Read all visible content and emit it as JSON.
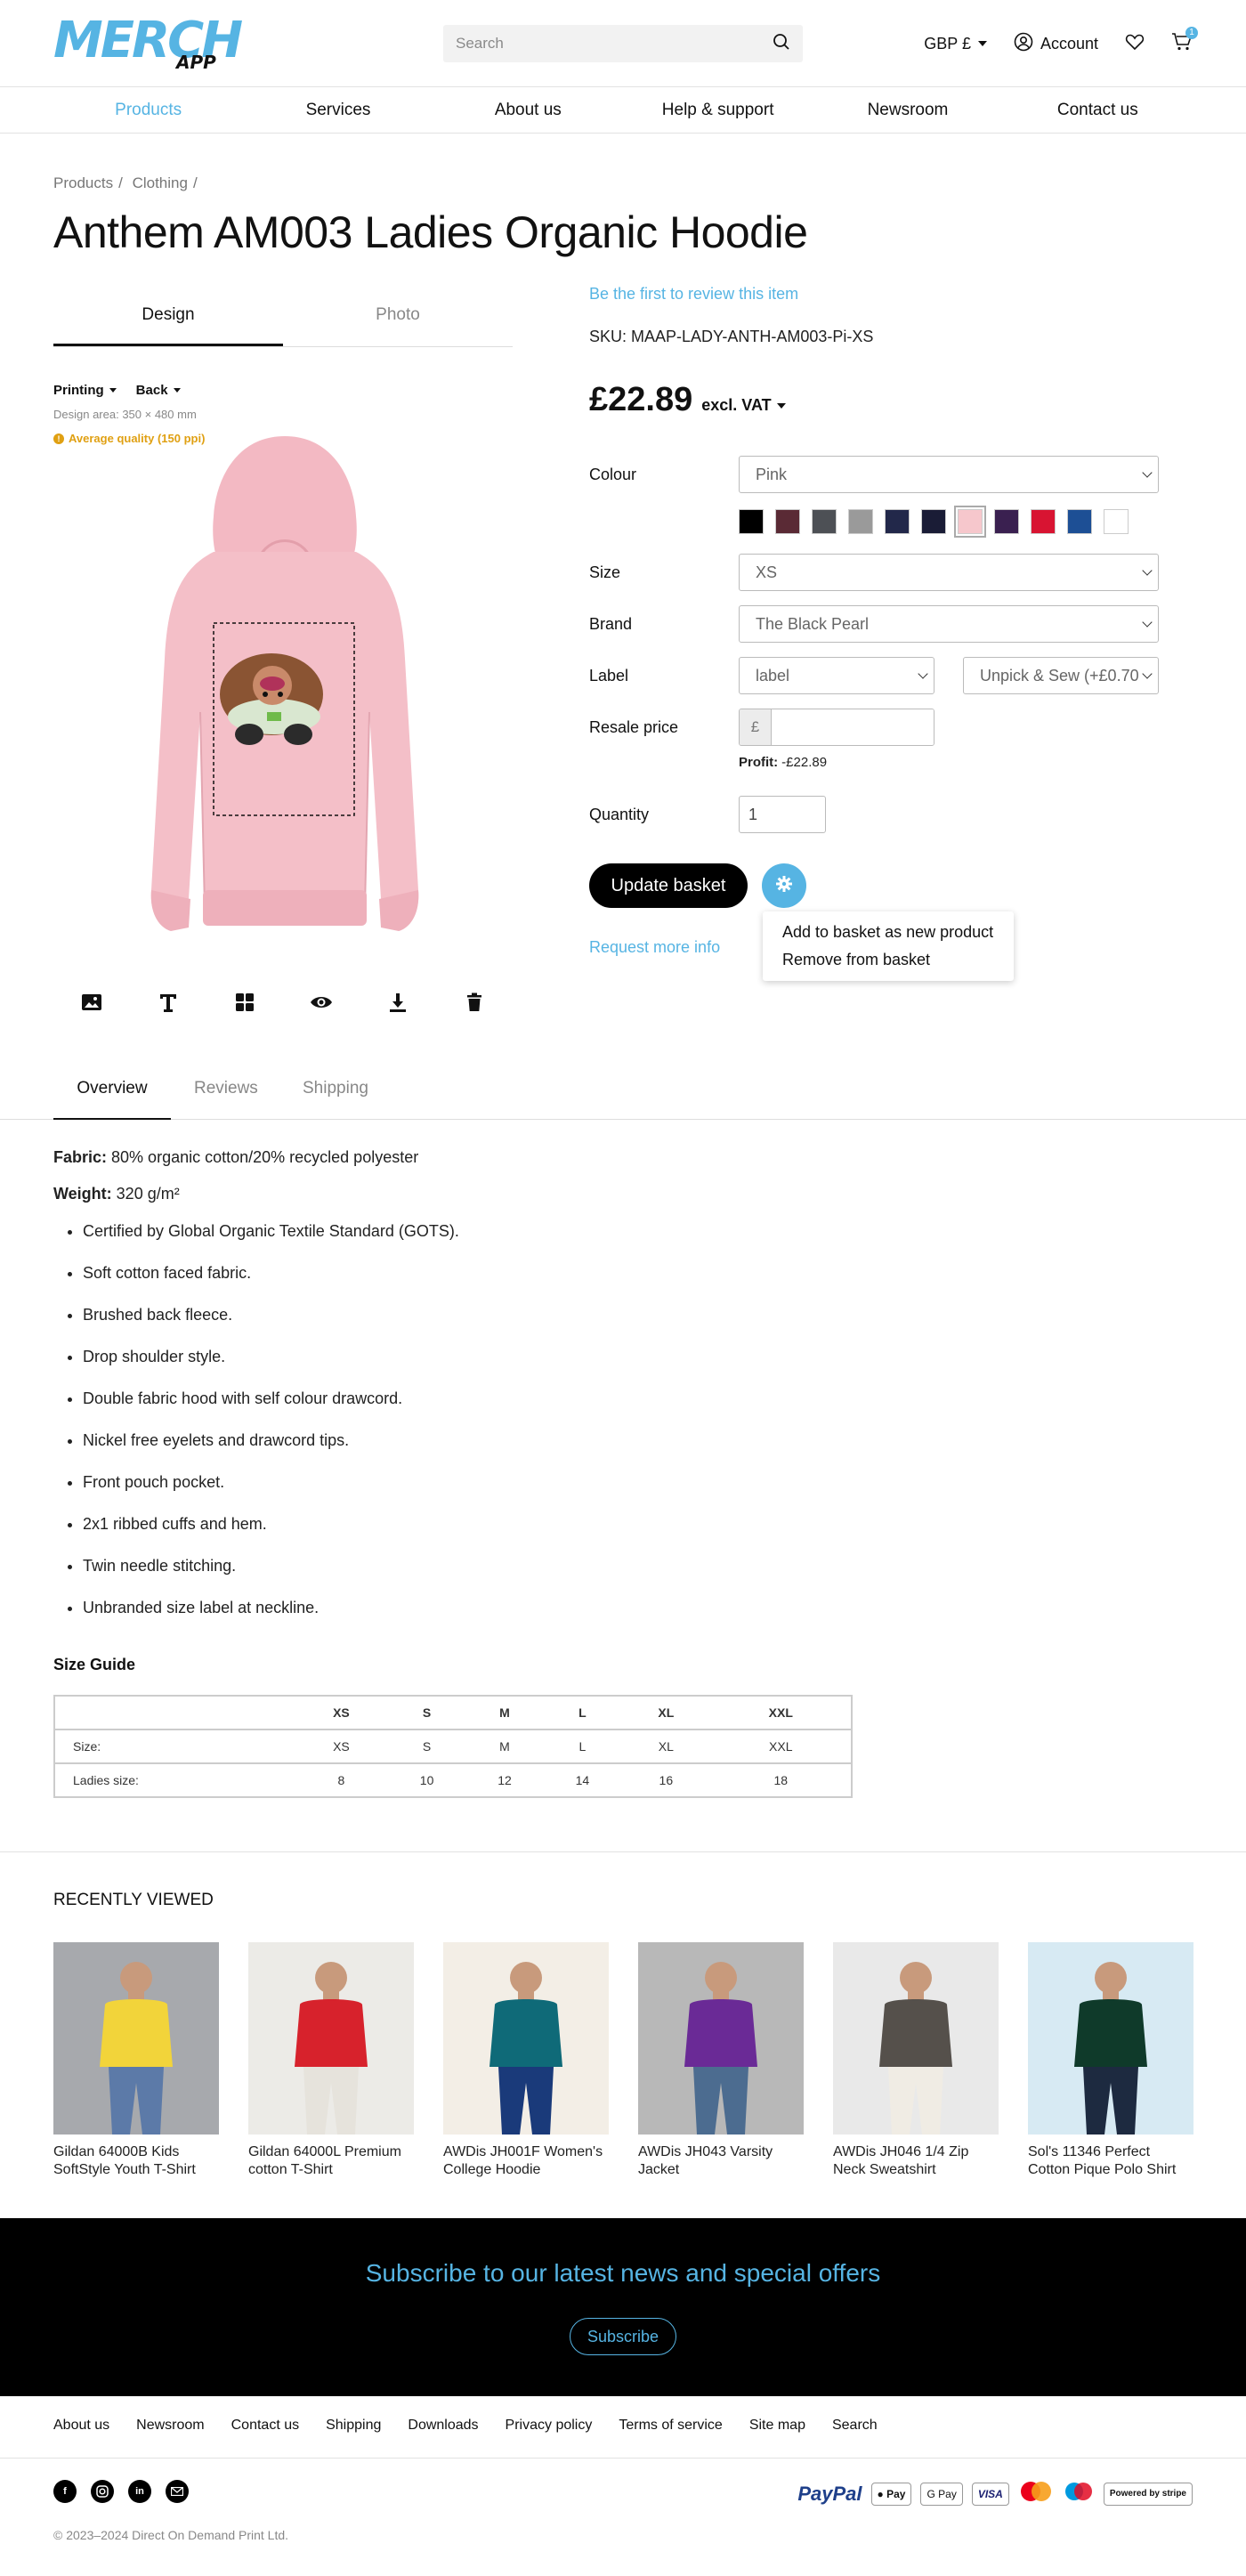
{
  "header": {
    "logo_text": "MERCH",
    "logo_sub": "APP",
    "search_placeholder": "Search",
    "currency": "GBP £",
    "account": "Account",
    "cart_count": "1",
    "accent": "#56b4e3"
  },
  "nav": [
    "Products",
    "Services",
    "About us",
    "Help & support",
    "Newsroom",
    "Contact us"
  ],
  "breadcrumb": [
    "Products",
    "/",
    "Clothing",
    "/"
  ],
  "product": {
    "title": "Anthem AM003 Ladies Organic Hoodie",
    "tabs": [
      "Design",
      "Photo"
    ],
    "printing": "Printing",
    "side": "Back",
    "design_area": "Design area: 350 × 480 mm",
    "quality": "Average quality (150 ppi)",
    "review_link": "Be the first to review this item",
    "sku": "SKU: MAAP-LADY-ANTH-AM003-Pi-XS",
    "price": "£22.89",
    "vat": "excl. VAT",
    "colour_label": "Colour",
    "colour_value": "Pink",
    "swatches": [
      "#000000",
      "#5a2a35",
      "#4d5055",
      "#9a9a9a",
      "#22284a",
      "#1a1c36",
      "#f6c7cc",
      "#3a2050",
      "#d81432",
      "#1d4f95",
      "#ffffff"
    ],
    "size_label": "Size",
    "size_value": "XS",
    "brand_label": "Brand",
    "brand_value": "The Black Pearl",
    "label_label": "Label",
    "label_value": "label",
    "label_option": "Unpick & Sew (+£0.70",
    "resale_label": "Resale price",
    "resale_currency": "£",
    "profit_label": "Profit:",
    "profit_value": "-£22.89",
    "quantity_label": "Quantity",
    "quantity_value": "1",
    "update_button": "Update basket",
    "more_info": "Request more info",
    "menu": [
      "Add to basket as new product",
      "Remove from basket"
    ]
  },
  "info_tabs": [
    "Overview",
    "Reviews",
    "Shipping"
  ],
  "details": {
    "fabric_label": "Fabric:",
    "fabric": "80% organic cotton/20% recycled polyester",
    "weight_label": "Weight:",
    "weight": "320 g/m²",
    "features": [
      "Certified by Global Organic Textile Standard (GOTS).",
      "Soft cotton faced fabric.",
      "Brushed back fleece.",
      "Drop shoulder style.",
      "Double fabric hood with self colour drawcord.",
      "Nickel free eyelets and drawcord tips.",
      "Front pouch pocket.",
      "2x1 ribbed cuffs and hem.",
      "Twin needle stitching.",
      "Unbranded size label at neckline."
    ]
  },
  "size_guide": {
    "title": "Size Guide",
    "headers": [
      "",
      "XS",
      "S",
      "M",
      "L",
      "XL",
      "XXL"
    ],
    "rows": [
      [
        "Size:",
        "XS",
        "S",
        "M",
        "L",
        "XL",
        "XXL"
      ],
      [
        "Ladies size:",
        "8",
        "10",
        "12",
        "14",
        "16",
        "18"
      ]
    ]
  },
  "recently_viewed": {
    "title": "RECENTLY VIEWED",
    "items": [
      {
        "name": "Gildan 64000B Kids SoftStyle Youth T-Shirt",
        "bg": "#a7a9ad",
        "shirt": "#f2d43a",
        "pants": "#5c7aa8"
      },
      {
        "name": "Gildan 64000L Premium cotton T-Shirt",
        "bg": "#ecebe7",
        "shirt": "#d7222c",
        "pants": "#e6e3dc"
      },
      {
        "name": "AWDis JH001F Women's College Hoodie",
        "bg": "#f3eee6",
        "shirt": "#0f6a78",
        "pants": "#1a3a7a"
      },
      {
        "name": "AWDis JH043 Varsity Jacket",
        "bg": "#b8b8b8",
        "shirt": "#6a2a96",
        "pants": "#4c6c90"
      },
      {
        "name": "AWDis JH046 1/4 Zip Neck Sweatshirt",
        "bg": "#e9e9e9",
        "shirt": "#55504b",
        "pants": "#f0ece4"
      },
      {
        "name": "Sol's 11346 Perfect Cotton Pique Polo Shirt",
        "bg": "#d7eaf3",
        "shirt": "#0f3a2a",
        "pants": "#1d2a40"
      }
    ]
  },
  "subscribe": {
    "title": "Subscribe to our latest news and special offers",
    "button": "Subscribe"
  },
  "footer": {
    "links": [
      "About us",
      "Newsroom",
      "Contact us",
      "Shipping",
      "Downloads",
      "Privacy policy",
      "Terms of service",
      "Site map",
      "Search"
    ],
    "payments": [
      "Pay",
      "G Pay",
      "VISA",
      "Powered by stripe"
    ],
    "paypal": "PayPal",
    "copyright": "© 2023–2024 Direct On Demand Print Ltd."
  }
}
